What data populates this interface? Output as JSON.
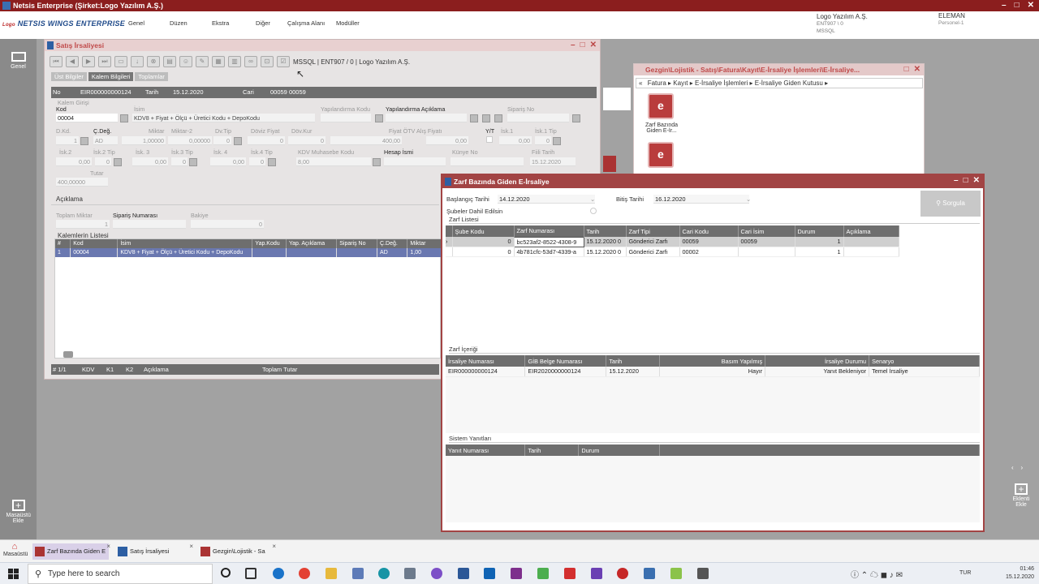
{
  "app": {
    "title": "Netsis Enterprise (Şirket:Logo Yazılım A.Ş.)",
    "brand_prefix": "Logo",
    "brand": "NETSIS WINGS ENTERPRISE",
    "menu": [
      "Genel",
      "Düzen",
      "Ekstra",
      "Diğer",
      "Çalışma Alanı",
      "Modüller"
    ],
    "company": "Logo Yazılım A.Ş.",
    "company_sub1": "ENT907 \\ 0",
    "company_sub2": "MSSQL",
    "user": "ELEMAN",
    "user_sub": "Personel-1",
    "left_genel": "Genel",
    "left_desktop": "Masaüstü Ekle",
    "right_attach": "Eklenti Ekle"
  },
  "satis": {
    "title": "Satış İrsaliyesi",
    "conn": "MSSQL | ENT907 / 0 | Logo Yazılım A.Ş.",
    "tabs": [
      "Üst Bilgiler",
      "Kalem Bilgileri",
      "Toplamlar"
    ],
    "header": {
      "no_lbl": "No",
      "no": "EIR000000000124",
      "tarih_lbl": "Tarih",
      "tarih": "15.12.2020",
      "cari_lbl": "Cari",
      "cari": "00059 00059"
    },
    "kalem_girisi": "Kalem Girişi",
    "kod_lbl": "Kod",
    "kod": "00004",
    "isim_lbl": "İsim",
    "isim": "KDV8 + Fiyat + Ölçü + Üretici Kodu + DepoKodu",
    "yap_kodu": "Yapılandırma Kodu",
    "yap_acik": "Yapılandırma Açıklama",
    "siparis_no": "Sipariş No",
    "row2_labels": [
      "D.Kd.",
      "Ç.Değ.",
      "Miktar",
      "Miktar-2",
      "Dv.Tip",
      "Döviz Fiyat",
      "Döv.Kur",
      "Fiyat ÖTV Alış Fiyatı",
      "Y/T",
      "İsk.1",
      "İsk.1 Tip"
    ],
    "row2_vals": [
      "1",
      "AD",
      "1,00000",
      "0,00000",
      "0",
      "0",
      "0",
      "400,00",
      "0,00",
      "0,00",
      "0"
    ],
    "row3_labels": [
      "İsk.2",
      "İsk.2 Tip",
      "İsk. 3",
      "İsk.3 Tip",
      "İsk. 4",
      "İsk.4 Tip",
      "KDV Muhasebe Kodu",
      "Hesap İsmi",
      "Künye No",
      "Fiili Tarih"
    ],
    "row3_vals": [
      "0,00",
      "0",
      "0,00",
      "0",
      "0,00",
      "0",
      "8,00",
      "15.12.2020"
    ],
    "tutar_lbl": "Tutar",
    "tutar": "400,00000",
    "aciklama": "Açıklama",
    "toplam_miktar_lbl": "Toplam Miktar",
    "toplam_miktar": "1",
    "siparis_numarasi": "Sipariş Numarası",
    "bakiye_lbl": "Bakiye",
    "bakiye": "0",
    "list_title": "Kalemlerin Listesi",
    "list_cols": [
      "#",
      "Kod",
      "İsim",
      "Yap.Kodu",
      "Yap. Açıklama",
      "Sipariş No",
      "Ç.Değ.",
      "Miktar"
    ],
    "list_rows": [
      [
        "1",
        "00004",
        "KDV8 + Fiyat + Ölçü + Üretici Kodu + DepoKodu",
        "",
        "",
        "",
        "AD",
        "1,00"
      ]
    ],
    "footer": [
      "# 1/1",
      "KDV",
      "K1",
      "K2",
      "Açıklama",
      "Toplam Tutar"
    ]
  },
  "gezgin": {
    "title": "Gezgin\\Lojistik - Satış\\Fatura\\Kayıt\\E-İrsaliye İşlemleri\\E-İrsaliye...",
    "crumb": [
      "«",
      "Fatura",
      "Kayıt",
      "E-İrsaliye İşlemleri",
      "E-İrsaliye Giden Kutusu"
    ],
    "icon1": "Zarf Bazında Giden E-İr..."
  },
  "zarf": {
    "title": "Zarf Bazında Giden E-İrsaliye",
    "bas_lbl": "Başlangıç Tarihi",
    "bas": "14.12.2020",
    "bit_lbl": "Bitiş Tarihi",
    "bit": "16.12.2020",
    "sube_lbl": "Şubeler Dahil Edilsin",
    "sorgula": "Sorgula",
    "list1_title": "Zarf Listesi",
    "cols1": [
      "Şube Kodu",
      "Zarf Numarası",
      "Tarih",
      "Zarf Tipi",
      "Cari Kodu",
      "Cari İsim",
      "Durum",
      "Açıklama"
    ],
    "rows1": [
      [
        "0",
        "bc523af2-8522-4308-9",
        "15.12.2020 0",
        "Gönderici Zarfı",
        "00059",
        "00059",
        "1",
        ""
      ],
      [
        "0",
        "4b781cfc-53d7-4339-a",
        "15.12.2020 0",
        "Gönderici Zarfı",
        "00002",
        "",
        "1",
        ""
      ]
    ],
    "list2_title": "Zarf İçeriği",
    "cols2": [
      "İrsaliye Numarası",
      "GİB Belge Numarası",
      "Tarih",
      "Basım Yapılmış",
      "İrsaliye Durumu",
      "Senaryo"
    ],
    "rows2": [
      [
        "EIR000000000124",
        "EIR2020000000124",
        "15.12.2020",
        "Hayır",
        "Yanıt Bekleniyor",
        "Temel İrsaliye"
      ]
    ],
    "list3_title": "Sistem Yanıtları",
    "cols3": [
      "Yanıt Numarası",
      "Tarih",
      "Durum"
    ]
  },
  "apptabs": [
    {
      "label": "Zarf Bazında Giden E"
    },
    {
      "label": "Satış İrsaliyesi"
    },
    {
      "label": "Gezgin\\Lojistik - Sa"
    }
  ],
  "taskbar": {
    "desktop": "Masaüstü",
    "search": "Type here to search",
    "lang": "TUR",
    "time": "01:46",
    "date": "15.12.2020"
  }
}
